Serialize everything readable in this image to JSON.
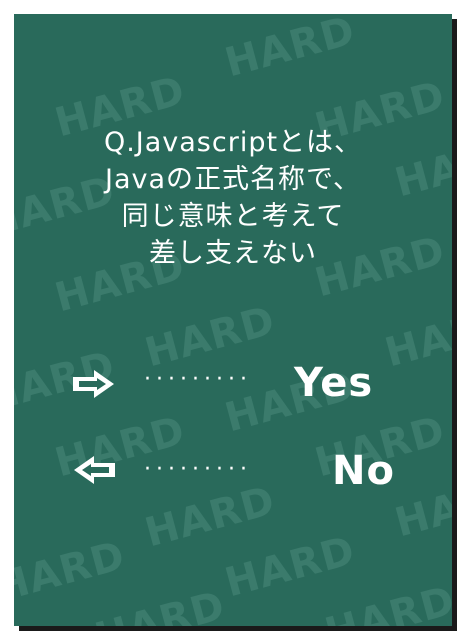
{
  "watermark": "HARD",
  "question_lines": [
    "Q.Javascriptとは、",
    "Javaの正式名称で、",
    "同じ意味と考えて",
    "差し支えない"
  ],
  "answers": {
    "yes": {
      "dots": "·········",
      "label": "Yes",
      "icon": "arrow-right-icon"
    },
    "no": {
      "dots": "·········",
      "label": "No",
      "icon": "arrow-left-icon"
    }
  },
  "colors": {
    "card_background": "#296a5b",
    "watermark": "#3b7b6c",
    "text": "#ffffff",
    "shadow": "#1a1a1a"
  }
}
